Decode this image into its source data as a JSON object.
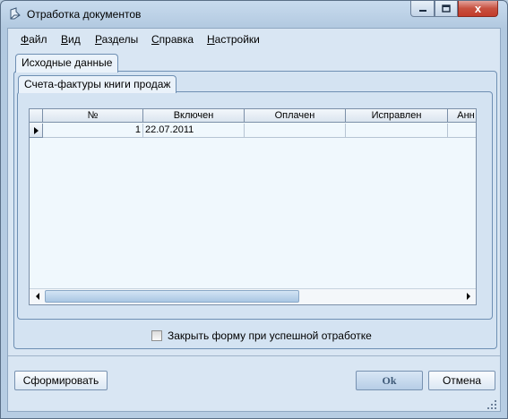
{
  "window": {
    "title": "Отработка документов",
    "close_glyph": "x",
    "colors": {
      "frame": "#b9cde0",
      "client": "#d9e6f3",
      "close": "#c7503f"
    }
  },
  "menu": {
    "items": [
      {
        "label": "Файл"
      },
      {
        "label": "Вид"
      },
      {
        "label": "Разделы"
      },
      {
        "label": "Справка"
      },
      {
        "label": "Настройки"
      }
    ]
  },
  "tabs": {
    "outer": "Исходные данные",
    "inner": "Счета-фактуры книги продаж"
  },
  "grid": {
    "columns": [
      "№",
      "Включен",
      "Оплачен",
      "Исправлен",
      "Анн"
    ],
    "rows": [
      {
        "num": "1",
        "included": "22.07.2011",
        "paid": "",
        "corrected": "",
        "ann": ""
      }
    ]
  },
  "options": {
    "close_on_success_label": "Закрыть форму при успешной отработке",
    "close_on_success_checked": false
  },
  "buttons": {
    "generate": "Сформировать",
    "ok": "Ok",
    "cancel": "Отмена"
  },
  "icons": {
    "app": "document-app-icon",
    "minimize": "minimize-icon",
    "maximize": "maximize-icon",
    "close": "close-icon",
    "row_indicator": "row-pointer-icon",
    "scroll_left": "scroll-left-icon",
    "scroll_right": "scroll-right-icon",
    "grip": "resize-grip-icon"
  }
}
